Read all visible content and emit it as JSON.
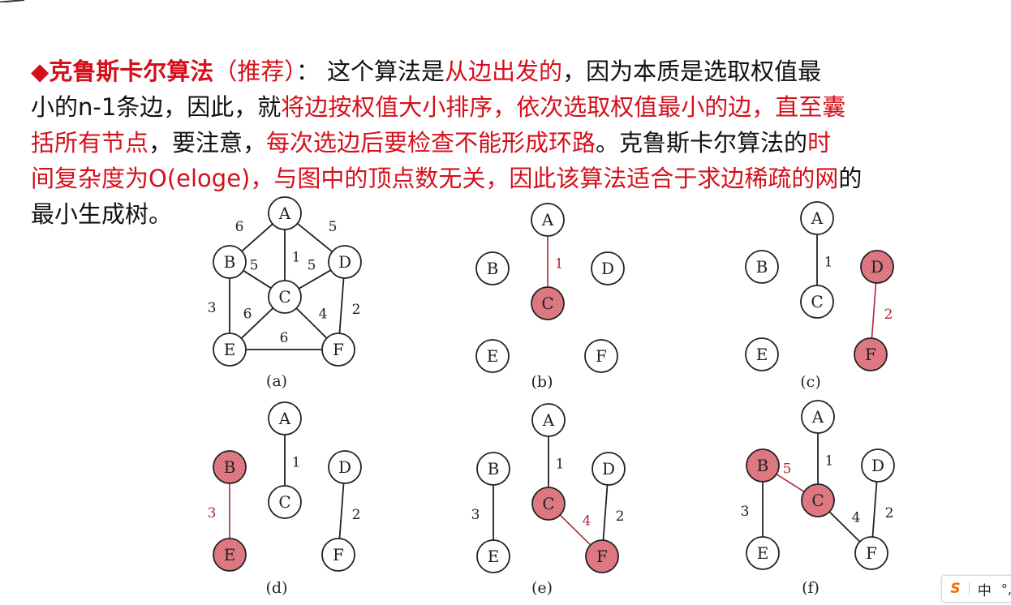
{
  "text": {
    "l1": [
      {
        "t": "◆克鲁斯卡尔算法",
        "c": "red",
        "b": true
      },
      {
        "t": "（推荐）",
        "c": "red",
        "b": false
      },
      {
        "t": "： 这个算法是",
        "c": "black",
        "b": false
      },
      {
        "t": "从边出发的",
        "c": "red",
        "b": false
      },
      {
        "t": "，因为本质是选取权值最",
        "c": "black",
        "b": false
      }
    ],
    "l2": [
      {
        "t": "小的n-1条边，因此，就",
        "c": "black",
        "b": false
      },
      {
        "t": "将边按权值大小排序，依次选取权值最小的边，直至囊",
        "c": "red",
        "b": false
      }
    ],
    "l3": [
      {
        "t": "括所有节点",
        "c": "red",
        "b": false
      },
      {
        "t": "，要注意，",
        "c": "black",
        "b": false
      },
      {
        "t": "每次选边后要检查不能形成环路",
        "c": "red",
        "b": false
      },
      {
        "t": "。克鲁斯卡尔算法的",
        "c": "black",
        "b": false
      },
      {
        "t": "时",
        "c": "red",
        "b": false
      }
    ],
    "l4": [
      {
        "t": "间复杂度为O(eloge)，与图中的顶点数无关，因此该算法适合于求边稀疏的网",
        "c": "red",
        "b": false
      },
      {
        "t": "的",
        "c": "black",
        "b": false
      }
    ],
    "l5": [
      {
        "t": "最小生成树。",
        "c": "black",
        "b": false
      }
    ]
  },
  "diagrams": {
    "nodes": [
      "A",
      "B",
      "C",
      "D",
      "E",
      "F"
    ],
    "panels": [
      {
        "caption": "(a)",
        "highlighted": [],
        "edges": [
          {
            "u": "A",
            "v": "B",
            "w": "6",
            "red": false
          },
          {
            "u": "A",
            "v": "D",
            "w": "5",
            "red": false
          },
          {
            "u": "A",
            "v": "C",
            "w": "1",
            "red": false
          },
          {
            "u": "B",
            "v": "C",
            "w": "5",
            "red": false
          },
          {
            "u": "D",
            "v": "C",
            "w": "5",
            "red": false
          },
          {
            "u": "B",
            "v": "E",
            "w": "3",
            "red": false
          },
          {
            "u": "D",
            "v": "F",
            "w": "2",
            "red": false
          },
          {
            "u": "C",
            "v": "E",
            "w": "6",
            "red": false
          },
          {
            "u": "C",
            "v": "F",
            "w": "4",
            "red": false
          },
          {
            "u": "E",
            "v": "F",
            "w": "6",
            "red": false
          }
        ]
      },
      {
        "caption": "(b)",
        "highlighted": [
          "C"
        ],
        "edges": [
          {
            "u": "A",
            "v": "C",
            "w": "1",
            "red": true
          }
        ]
      },
      {
        "caption": "(c)",
        "highlighted": [
          "D",
          "F"
        ],
        "edges": [
          {
            "u": "A",
            "v": "C",
            "w": "1",
            "red": false
          },
          {
            "u": "D",
            "v": "F",
            "w": "2",
            "red": true
          }
        ]
      },
      {
        "caption": "(d)",
        "highlighted": [
          "B",
          "E"
        ],
        "edges": [
          {
            "u": "A",
            "v": "C",
            "w": "1",
            "red": false
          },
          {
            "u": "D",
            "v": "F",
            "w": "2",
            "red": false
          },
          {
            "u": "B",
            "v": "E",
            "w": "3",
            "red": true
          }
        ]
      },
      {
        "caption": "(e)",
        "highlighted": [
          "C",
          "F"
        ],
        "edges": [
          {
            "u": "A",
            "v": "C",
            "w": "1",
            "red": false
          },
          {
            "u": "D",
            "v": "F",
            "w": "2",
            "red": false
          },
          {
            "u": "B",
            "v": "E",
            "w": "3",
            "red": false
          },
          {
            "u": "C",
            "v": "F",
            "w": "4",
            "red": true
          }
        ]
      },
      {
        "caption": "(f)",
        "highlighted": [
          "B",
          "C"
        ],
        "edges": [
          {
            "u": "A",
            "v": "C",
            "w": "1",
            "red": false
          },
          {
            "u": "D",
            "v": "F",
            "w": "2",
            "red": false
          },
          {
            "u": "B",
            "v": "E",
            "w": "3",
            "red": false
          },
          {
            "u": "C",
            "v": "F",
            "w": "4",
            "red": false
          },
          {
            "u": "B",
            "v": "C",
            "w": "5",
            "red": true
          }
        ]
      }
    ]
  },
  "ime": {
    "logo": "S",
    "mode": "中",
    "punct": "°,"
  },
  "colors": {
    "red_text": "#d5101b",
    "edge_red": "#b0283a",
    "node_fill_red": "#e8838b",
    "dark": "#111111"
  }
}
